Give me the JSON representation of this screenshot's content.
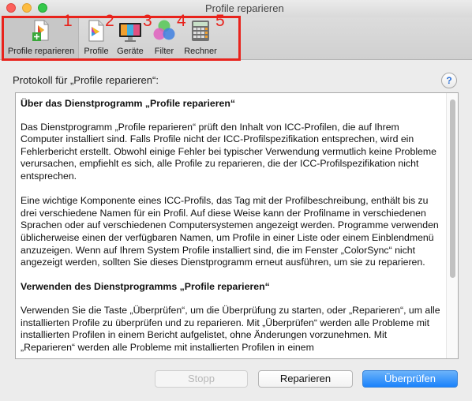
{
  "window": {
    "title": "Profile reparieren"
  },
  "toolbar": {
    "items": [
      {
        "label": "Profile reparieren",
        "icon": "profile-repair-icon",
        "selected": true
      },
      {
        "label": "Profile",
        "icon": "profile-icon"
      },
      {
        "label": "Geräte",
        "icon": "monitor-icon"
      },
      {
        "label": "Filter",
        "icon": "filter-icon"
      },
      {
        "label": "Rechner",
        "icon": "calculator-icon"
      }
    ],
    "annotations": [
      "1",
      "2",
      "3",
      "4",
      "5"
    ],
    "highlight_color": "#e8231c"
  },
  "main": {
    "label": "Protokoll für „Profile reparieren“:",
    "help": "?",
    "heading1": "Über das Dienstprogramm „Profile reparieren“",
    "p1": "Das Dienstprogramm „Profile reparieren“ prüft den Inhalt von ICC-Profilen, die auf Ihrem Computer installiert sind. Falls Profile nicht der ICC-Profilspezifikation entsprechen, wird ein Fehlerbericht erstellt. Obwohl einige Fehler bei typischer Verwendung vermutlich keine Probleme verursachen, empfiehlt es sich, alle Profile zu reparieren, die der ICC-Profilspezifikation nicht entsprechen.",
    "p2": "Eine wichtige Komponente eines ICC-Profils, das Tag mit der Profilbeschreibung, enthält bis zu drei verschiedene Namen für ein Profil. Auf diese Weise kann der Profilname in verschiedenen Sprachen oder auf verschiedenen Computersystemen angezeigt werden. Programme verwenden üblicherweise einen der verfügbaren Namen, um Profile in einer Liste oder einem Einblendmenü anzuzeigen. Wenn auf Ihrem System Profile installiert sind, die im Fenster „ColorSync“ nicht angezeigt werden, sollten Sie dieses Dienstprogramm erneut ausführen, um sie zu reparieren.",
    "heading2": "Verwenden des Dienstprogramms „Profile reparieren“",
    "p3": "Verwenden Sie die Taste „Überprüfen“, um die Überprüfung zu starten, oder „Reparieren“, um alle installierten Profile zu überprüfen und zu reparieren. Mit „Überprüfen“ werden alle Probleme mit installierten Profilen in einem Bericht aufgelistet, ohne Änderungen vorzunehmen. Mit „Reparieren“ werden alle Probleme mit installierten Profilen in einem"
  },
  "buttons": {
    "stop": "Stopp",
    "repair": "Reparieren",
    "check": "Überprüfen"
  },
  "colors": {
    "accent": "#1a82fb"
  }
}
